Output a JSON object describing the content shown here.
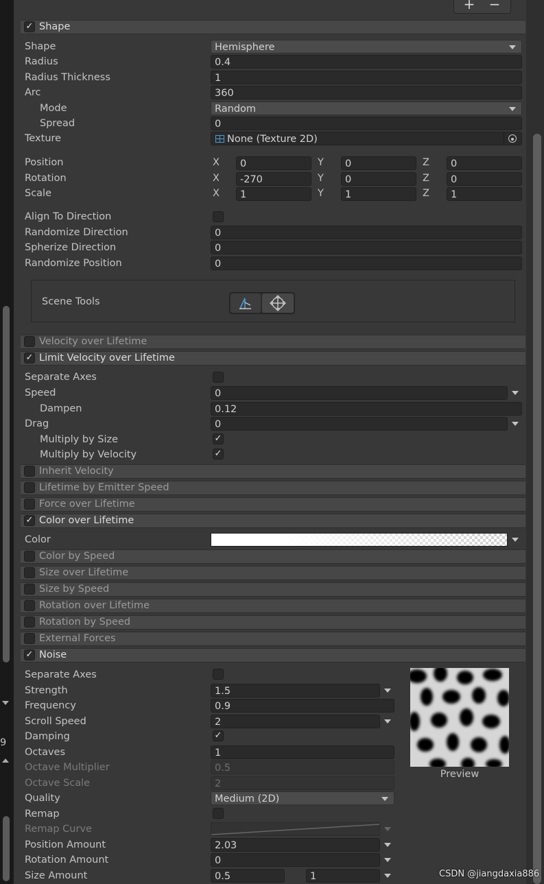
{
  "top_buttons": {
    "plus": "+",
    "minus": "−"
  },
  "shape_module": {
    "title": "Shape",
    "checked": true,
    "shape": {
      "label": "Shape",
      "value": "Hemisphere"
    },
    "radius": {
      "label": "Radius",
      "value": "0.4"
    },
    "radius_thickness": {
      "label": "Radius Thickness",
      "value": "1"
    },
    "arc": {
      "label": "Arc",
      "value": "360"
    },
    "mode": {
      "label": "Mode",
      "value": "Random"
    },
    "spread": {
      "label": "Spread",
      "value": "0"
    },
    "texture": {
      "label": "Texture",
      "value": "None (Texture 2D)"
    },
    "axis_labels": {
      "x": "X",
      "y": "Y",
      "z": "Z"
    },
    "position": {
      "label": "Position",
      "x": "0",
      "y": "0",
      "z": "0"
    },
    "rotation": {
      "label": "Rotation",
      "x": "-270",
      "y": "0",
      "z": "0"
    },
    "scale": {
      "label": "Scale",
      "x": "1",
      "y": "1",
      "z": "1"
    },
    "align_to_direction": {
      "label": "Align To Direction",
      "checked": false
    },
    "randomize_direction": {
      "label": "Randomize Direction",
      "value": "0"
    },
    "spherize_direction": {
      "label": "Spherize Direction",
      "value": "0"
    },
    "randomize_position": {
      "label": "Randomize Position",
      "value": "0"
    },
    "scene_tools": {
      "label": "Scene Tools"
    }
  },
  "modules": {
    "velocity_over_lifetime": {
      "title": "Velocity over Lifetime",
      "checked": false
    },
    "limit_velocity_over_lifetime": {
      "title": "Limit Velocity over Lifetime",
      "checked": true
    },
    "inherit_velocity": {
      "title": "Inherit Velocity",
      "checked": false
    },
    "lifetime_by_emitter_speed": {
      "title": "Lifetime by Emitter Speed",
      "checked": false
    },
    "force_over_lifetime": {
      "title": "Force over Lifetime",
      "checked": false
    },
    "color_over_lifetime": {
      "title": "Color over Lifetime",
      "checked": true
    },
    "color_by_speed": {
      "title": "Color by Speed",
      "checked": false
    },
    "size_over_lifetime": {
      "title": "Size over Lifetime",
      "checked": false
    },
    "size_by_speed": {
      "title": "Size by Speed",
      "checked": false
    },
    "rotation_over_lifetime": {
      "title": "Rotation over Lifetime",
      "checked": false
    },
    "rotation_by_speed": {
      "title": "Rotation by Speed",
      "checked": false
    },
    "external_forces": {
      "title": "External Forces",
      "checked": false
    },
    "noise": {
      "title": "Noise",
      "checked": true
    }
  },
  "limit_velocity": {
    "separate_axes": {
      "label": "Separate Axes",
      "checked": false
    },
    "speed": {
      "label": "Speed",
      "value": "0"
    },
    "dampen": {
      "label": "Dampen",
      "value": "0.12"
    },
    "drag": {
      "label": "Drag",
      "value": "0"
    },
    "multiply_by_size": {
      "label": "Multiply by Size",
      "checked": true
    },
    "multiply_by_velocity": {
      "label": "Multiply by Velocity",
      "checked": true
    }
  },
  "color_over_lifetime": {
    "color": {
      "label": "Color"
    }
  },
  "noise": {
    "separate_axes": {
      "label": "Separate Axes",
      "checked": false
    },
    "strength": {
      "label": "Strength",
      "value": "1.5"
    },
    "frequency": {
      "label": "Frequency",
      "value": "0.9"
    },
    "scroll_speed": {
      "label": "Scroll Speed",
      "value": "2"
    },
    "damping": {
      "label": "Damping",
      "checked": true
    },
    "octaves": {
      "label": "Octaves",
      "value": "1"
    },
    "octave_multiplier": {
      "label": "Octave Multiplier",
      "value": "0.5"
    },
    "octave_scale": {
      "label": "Octave Scale",
      "value": "2"
    },
    "quality": {
      "label": "Quality",
      "value": "Medium (2D)"
    },
    "remap": {
      "label": "Remap",
      "checked": false
    },
    "remap_curve": {
      "label": "Remap Curve"
    },
    "position_amount": {
      "label": "Position Amount",
      "value": "2.03"
    },
    "rotation_amount": {
      "label": "Rotation Amount",
      "value": "0"
    },
    "size_amount": {
      "label": "Size Amount",
      "min": "0.5",
      "max": "1"
    },
    "preview_label": "Preview"
  },
  "left_gutter": {
    "number": "9"
  },
  "watermark": "CSDN @jiangdaxia886",
  "colors": {
    "panel": "#383838",
    "header": "#474747",
    "field": "#2a2a2a",
    "accent": "#4a9bd6"
  }
}
